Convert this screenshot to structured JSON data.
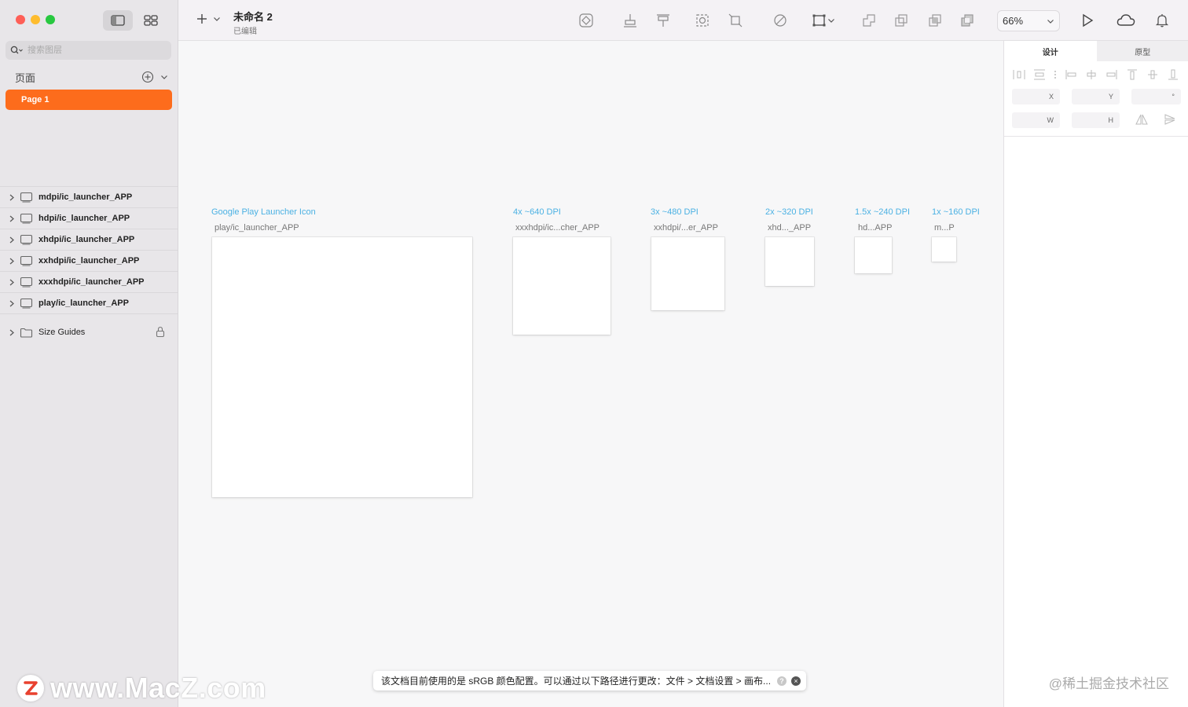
{
  "sidebar": {
    "search_placeholder": "搜索图层",
    "pages_label": "页面",
    "pages": [
      {
        "label": "Page 1",
        "selected": true
      }
    ],
    "layers": [
      {
        "label": "mdpi/ic_launcher_APP"
      },
      {
        "label": "hdpi/ic_launcher_APP"
      },
      {
        "label": "xhdpi/ic_launcher_APP"
      },
      {
        "label": "xxhdpi/ic_launcher_APP"
      },
      {
        "label": "xxxhdpi/ic_launcher_APP"
      },
      {
        "label": "play/ic_launcher_APP"
      }
    ],
    "group": {
      "label": "Size Guides",
      "locked": true
    }
  },
  "toolbar": {
    "doc_name": "未命名 2",
    "doc_status": "已编辑",
    "zoom": "66%"
  },
  "canvas": {
    "artboards": [
      {
        "label": "Google Play Launcher Icon",
        "name": "play/ic_launcher_APP"
      },
      {
        "label": "4x ~640 DPI",
        "name": "xxxhdpi/ic...cher_APP"
      },
      {
        "label": "3x ~480 DPI",
        "name": "xxhdpi/...er_APP"
      },
      {
        "label": "2x ~320 DPI",
        "name": "xhd..._APP"
      },
      {
        "label": "1.5x ~240 DPI",
        "name": "hd...APP"
      },
      {
        "label": "1x ~160 DPI",
        "name": "m...P"
      }
    ]
  },
  "inspector": {
    "tabs": [
      {
        "label": "设计",
        "active": true
      },
      {
        "label": "原型",
        "active": false
      }
    ],
    "fields": {
      "x": "X",
      "y": "Y",
      "w": "W",
      "h": "H",
      "angle": "°"
    }
  },
  "notification": {
    "message": "该文档目前使用的是 sRGB 颜色配置。可以通过以下路径进行更改：文件 > 文档设置 > 画布...",
    "help": "?",
    "close": "×"
  },
  "watermarks": {
    "left_logo_letter": "Z",
    "left_text": "www.MacZ.com",
    "right_text": "@稀土掘金技术社区"
  },
  "colors": {
    "accent": "#fd6c1c",
    "artboard_label": "#4bb1e3"
  }
}
